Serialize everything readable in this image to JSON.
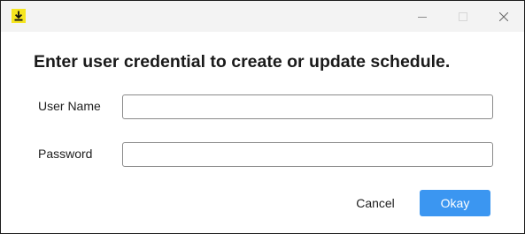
{
  "titlebar": {
    "app_icon": "download-arrow-icon",
    "controls": {
      "minimize_icon": "minimize-icon",
      "maximize_icon": "maximize-icon",
      "close_icon": "close-icon"
    }
  },
  "dialog": {
    "heading": "Enter user credential to create or update schedule.",
    "username": {
      "label": "User Name",
      "value": "",
      "placeholder": ""
    },
    "password": {
      "label": "Password",
      "value": "",
      "placeholder": ""
    },
    "buttons": {
      "cancel_label": "Cancel",
      "okay_label": "Okay"
    }
  },
  "colors": {
    "accent": "#3b96f1",
    "app_icon_bg": "#f5e51f",
    "titlebar_bg": "#f3f3f3"
  }
}
